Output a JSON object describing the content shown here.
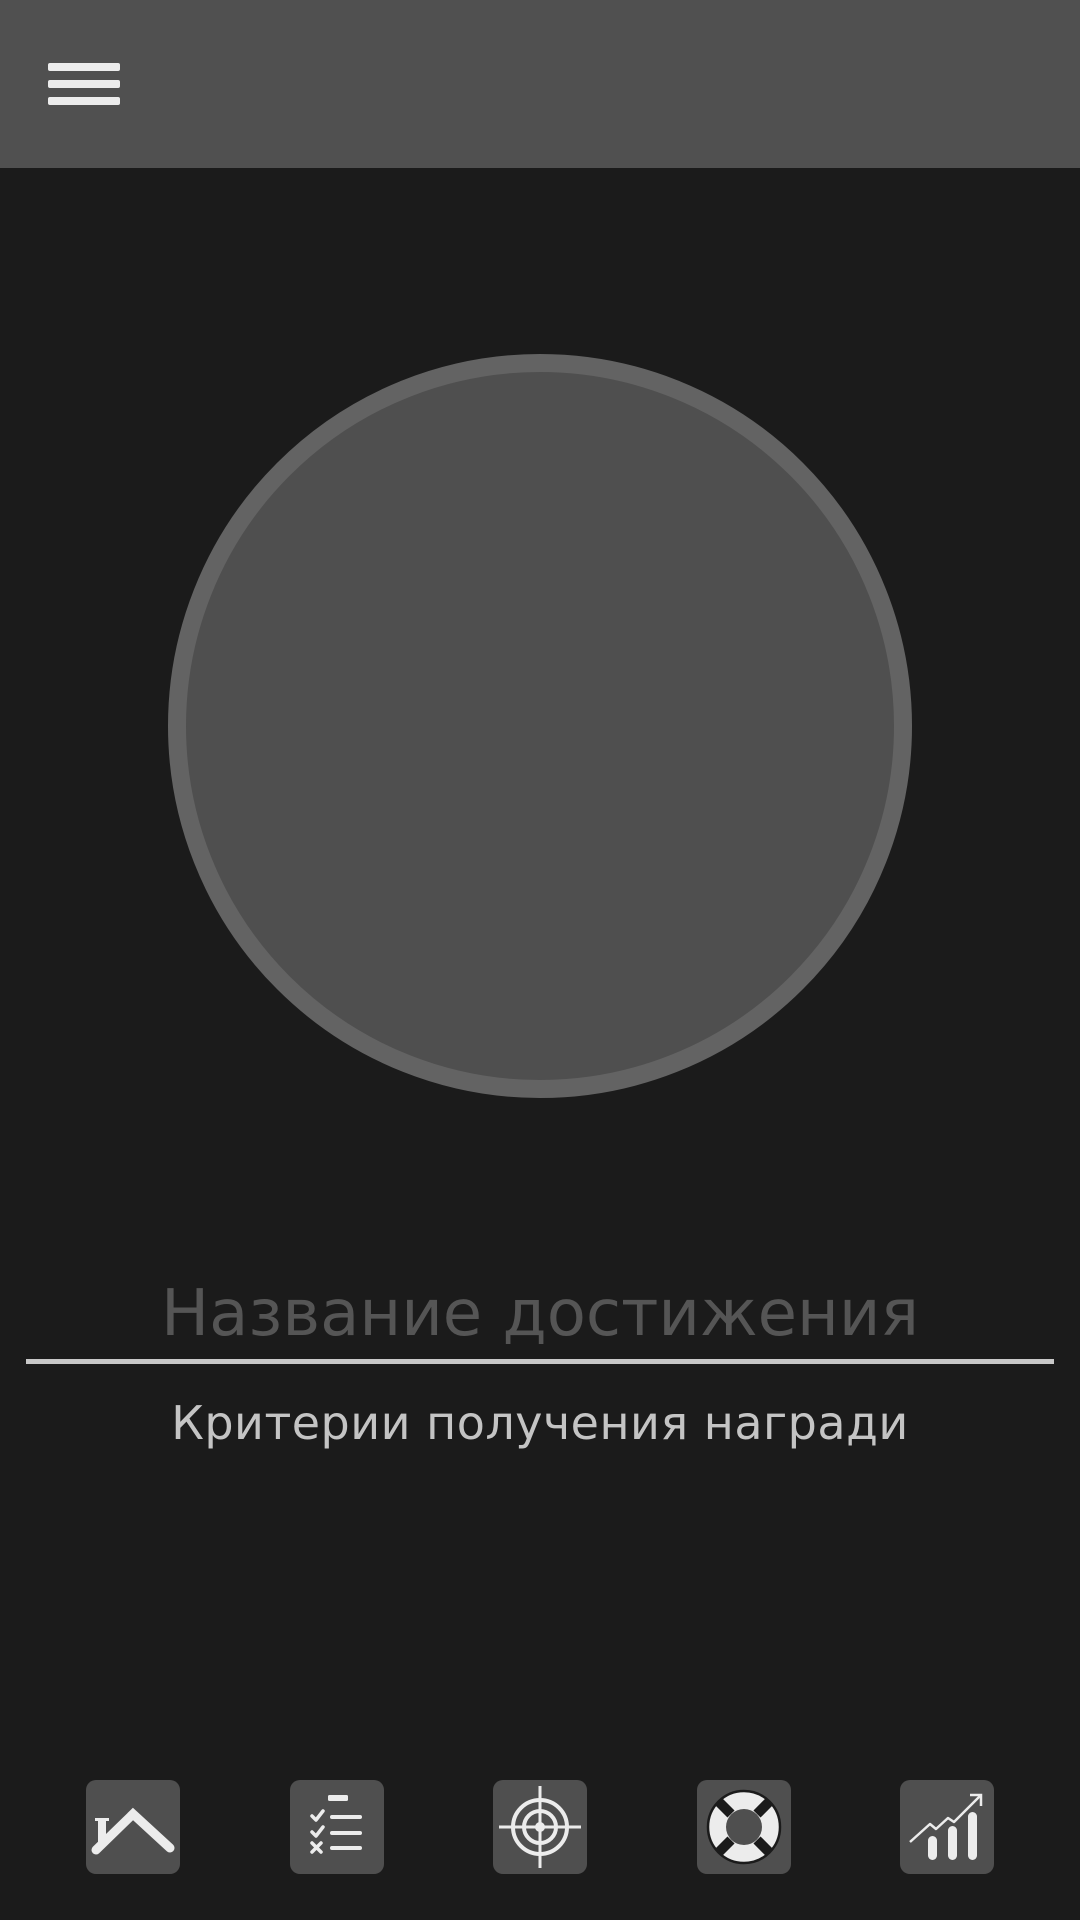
{
  "header": {
    "menu_icon": "hamburger-menu-icon"
  },
  "achievement": {
    "image_placeholder": "badge-circle",
    "title_placeholder": "Название достижения",
    "title_value": "",
    "criteria": "Критерии получения награди"
  },
  "nav": {
    "items": [
      {
        "icon": "home-icon"
      },
      {
        "icon": "checklist-icon"
      },
      {
        "icon": "target-icon"
      },
      {
        "icon": "lifebuoy-icon"
      },
      {
        "icon": "growth-chart-icon"
      }
    ]
  },
  "colors": {
    "background": "#1b1b1b",
    "top_bar": "#505050",
    "circle_fill": "#4f4f4f",
    "circle_border": "#636363",
    "nav_button": "#4f4f4f",
    "icon": "#ececec"
  }
}
